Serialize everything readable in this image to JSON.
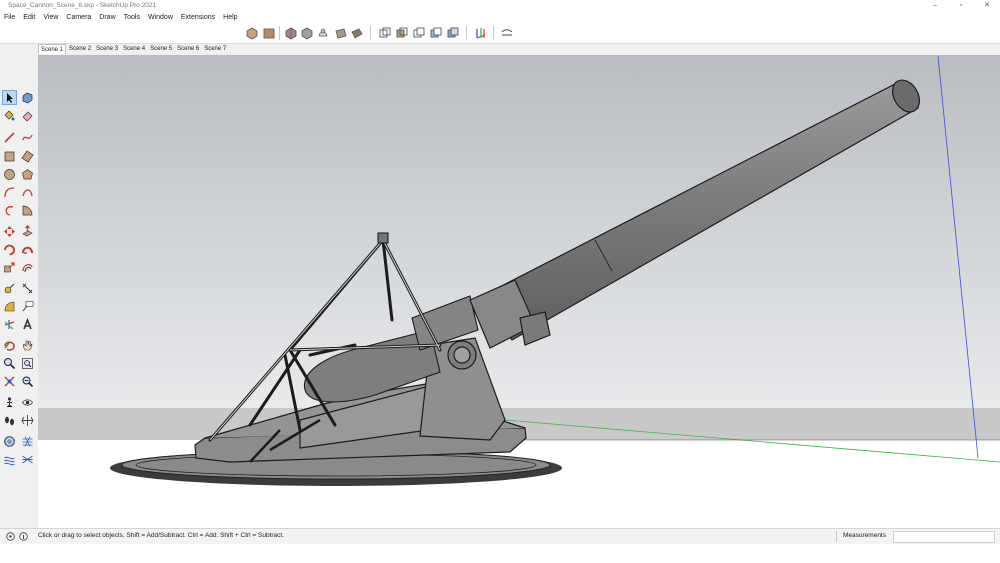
{
  "window": {
    "title": "Space_Cannon_Scene_6.skp - SketchUp Pro 2021",
    "minimize": "–",
    "maximize": "▫",
    "close": "✕"
  },
  "menu": [
    "File",
    "Edit",
    "View",
    "Camera",
    "Draw",
    "Tools",
    "Window",
    "Extensions",
    "Help"
  ],
  "scenes": [
    "Scene 1",
    "Scene 2",
    "Scene 3",
    "Scene 4",
    "Scene 5",
    "Scene 6",
    "Scene 7"
  ],
  "active_scene": "Scene 1",
  "status": {
    "hint": "Click or drag to select objects. Shift = Add/Subtract. Ctrl = Add. Shift + Ctrl = Subtract.",
    "measurements_label": "Measurements",
    "measurements_value": ""
  },
  "colors": {
    "select_highlight": "#bcd6f0",
    "axis_green": "#3cb44b",
    "axis_blue": "#3b4fd8",
    "model_gray": "#7d7d7d"
  }
}
